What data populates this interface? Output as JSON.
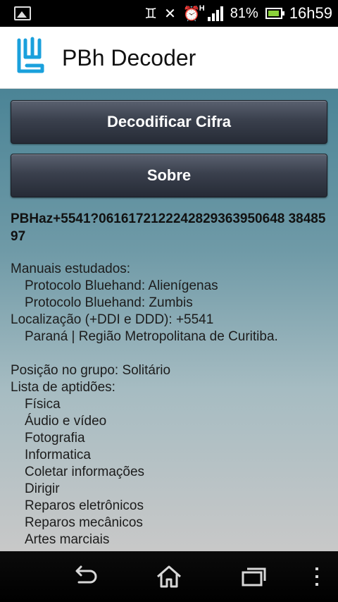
{
  "status_bar": {
    "left_icon": "image-icon",
    "network_indicator": "H",
    "battery_percent": "81%",
    "time": "16h59"
  },
  "app": {
    "title": "PBh Decoder",
    "brand_color": "#1aa0dc"
  },
  "buttons": {
    "decode": "Decodificar Cifra",
    "about": "Sobre"
  },
  "result": {
    "code": "PBHaz+5541?0616172122242829363950648 3848597",
    "manuals_header": "Manuais estudados:",
    "manuals": [
      "Protocolo Bluehand: Alienígenas",
      "Protocolo Bluehand: Zumbis"
    ],
    "location_line": "Localização (+DDI e DDD): +5541",
    "location_detail": "Paraná | Região Metropolitana de Curitiba.",
    "group_position": "Posição no grupo: Solitário",
    "skills_header": "Lista de aptidões:",
    "skills": [
      "Física",
      "Áudio e vídeo",
      "Fotografia",
      "Informatica",
      "Coletar informações",
      "Dirigir",
      "Reparos eletrônicos",
      "Reparos mecânicos",
      "Artes marciais"
    ]
  },
  "nav_bar": {
    "icons": [
      "back-icon",
      "home-icon",
      "recent-apps-icon",
      "menu-icon"
    ]
  }
}
